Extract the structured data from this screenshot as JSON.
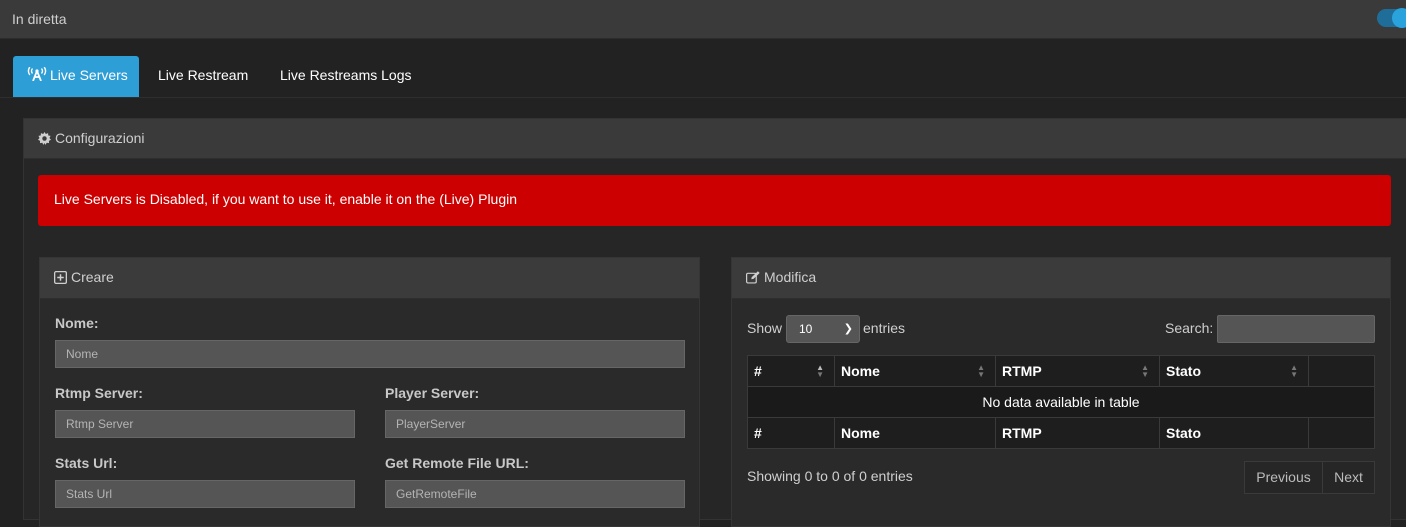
{
  "topbar": {
    "title": "In diretta",
    "toggle_on": true
  },
  "tabs": [
    {
      "label": "Live Servers",
      "active": true,
      "icon": "broadcast-tower-icon"
    },
    {
      "label": "Live Restream",
      "active": false
    },
    {
      "label": "Live Restreams Logs",
      "active": false
    }
  ],
  "panel": {
    "title": "Configurazioni",
    "icon": "gear-icon"
  },
  "alert": {
    "text": "Live Servers is Disabled, if you want to use it, enable it on the (Live) Plugin",
    "color": "#cc0000"
  },
  "create": {
    "title": "Creare",
    "icon": "plus-square-icon",
    "fields": [
      {
        "label": "Nome:",
        "placeholder": "Nome"
      },
      {
        "label": "Rtmp Server:",
        "placeholder": "Rtmp Server"
      },
      {
        "label": "Player Server:",
        "placeholder": "PlayerServer"
      },
      {
        "label": "Stats Url:",
        "placeholder": "Stats Url"
      },
      {
        "label": "Get Remote File URL:",
        "placeholder": "GetRemoteFile"
      }
    ]
  },
  "modify": {
    "title": "Modifica",
    "icon": "edit-icon",
    "show_label": "Show",
    "entries_label": "entries",
    "page_size": "10",
    "search_label": "Search:",
    "search_value": "",
    "columns": [
      "#",
      "Nome",
      "RTMP",
      "Stato",
      ""
    ],
    "empty_text": "No data available in table",
    "info": "Showing 0 to 0 of 0 entries",
    "prev_label": "Previous",
    "next_label": "Next"
  },
  "colors": {
    "accent": "#2e9ed6",
    "danger": "#cc0000",
    "background": "#222222"
  }
}
